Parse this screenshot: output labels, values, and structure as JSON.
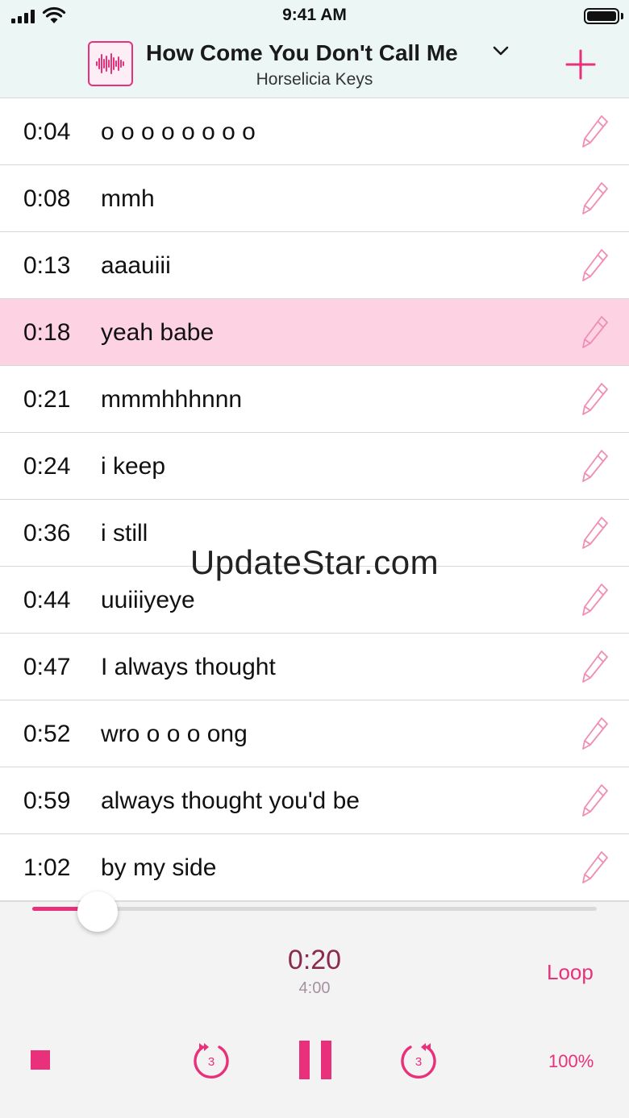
{
  "status": {
    "time": "9:41 AM"
  },
  "header": {
    "title": "How Come You Don't Call Me",
    "artist": "Horselicia Keys"
  },
  "lyrics": [
    {
      "time": "0:04",
      "text": "o o o o o o o o"
    },
    {
      "time": "0:08",
      "text": "mmh"
    },
    {
      "time": "0:13",
      "text": "aaauiii"
    },
    {
      "time": "0:18",
      "text": "yeah babe",
      "active": true
    },
    {
      "time": "0:21",
      "text": "mmmhhhnnn"
    },
    {
      "time": "0:24",
      "text": "i keep"
    },
    {
      "time": "0:36",
      "text": "i still"
    },
    {
      "time": "0:44",
      "text": "uuiiiyeye"
    },
    {
      "time": "0:47",
      "text": "I always thought"
    },
    {
      "time": "0:52",
      "text": "wro o o o ong"
    },
    {
      "time": "0:59",
      "text": "always thought you'd be"
    },
    {
      "time": "1:02",
      "text": "by my side"
    }
  ],
  "watermark": "UpdateStar.com",
  "player": {
    "current": "0:20",
    "total": "4:00",
    "progress": 0.115,
    "loop_label": "Loop",
    "speed_label": "100%",
    "skip_seconds": "3"
  },
  "colors": {
    "accent": "#e8317a",
    "header_bg": "#ebf6f5",
    "active_row": "#fdd3e3"
  }
}
